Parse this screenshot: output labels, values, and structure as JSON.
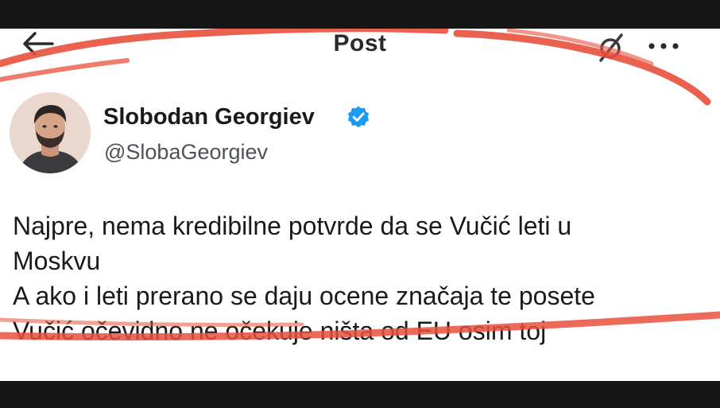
{
  "header": {
    "title": "Post",
    "back_icon": "arrow-left-icon",
    "filter_icon": "filter-off-icon",
    "more_icon": "more-horizontal-icon"
  },
  "author": {
    "display_name": "Slobodan Georgiev",
    "handle": "@SlobaGeorgiev",
    "verified_icon": "verified-badge-icon",
    "verified_color": "#1d9bf0"
  },
  "tweet": {
    "lines": [
      "Najpre, nema kredibilne potvrde da se Vučić leti u",
      "Moskvu",
      "A ako i leti prerano se daju ocene značaja te posete",
      "Vučić očevidno ne očekuje ništa od EU osim toj"
    ]
  },
  "annotation": {
    "color": "#e8503c"
  }
}
